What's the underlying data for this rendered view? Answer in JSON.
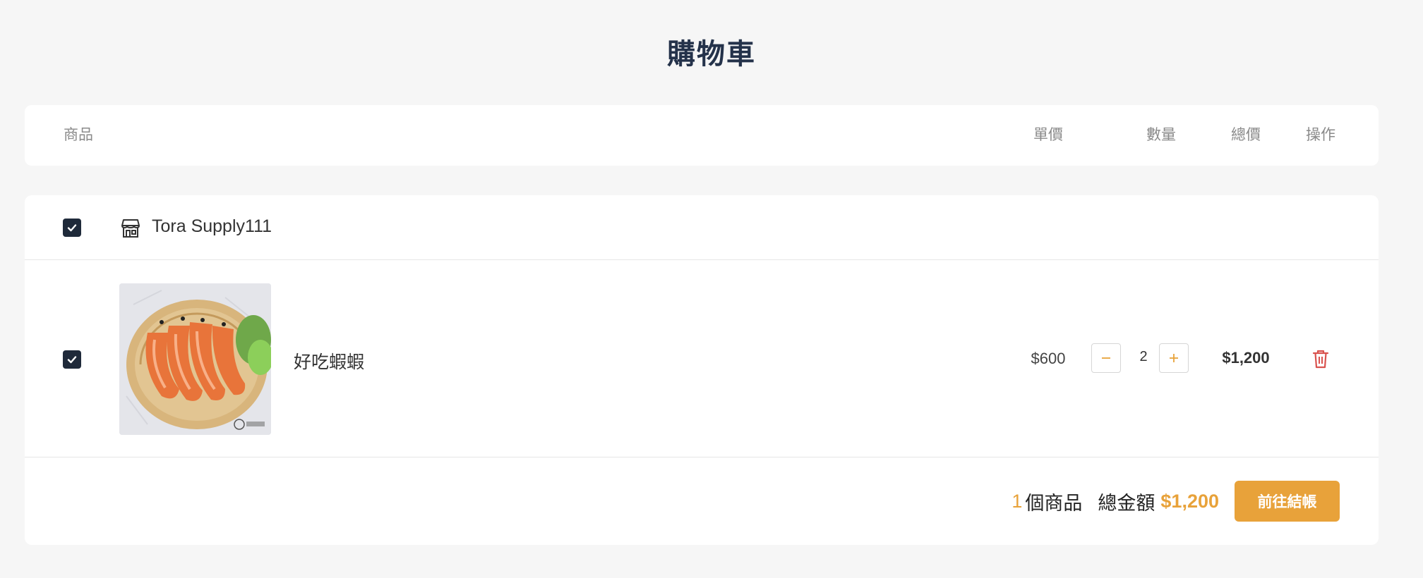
{
  "page": {
    "title": "購物車"
  },
  "table_header": {
    "product": "商品",
    "unit_price": "單價",
    "quantity": "數量",
    "total": "總價",
    "action": "操作"
  },
  "store": {
    "name": "Tora Supply111",
    "checked": true,
    "icon": "store-icon"
  },
  "items": [
    {
      "name": "好吃蝦蝦",
      "unit_price": "$600",
      "quantity": "2",
      "total": "$1,200",
      "checked": true
    }
  ],
  "summary": {
    "count": "1",
    "count_label": "個商品",
    "total_label": "總金額",
    "total_value": "$1,200",
    "checkout_label": "前往結帳"
  },
  "colors": {
    "accent": "#e8a23a",
    "title": "#24324a",
    "checkbox": "#1f2a3a",
    "trash": "#d9534f"
  }
}
